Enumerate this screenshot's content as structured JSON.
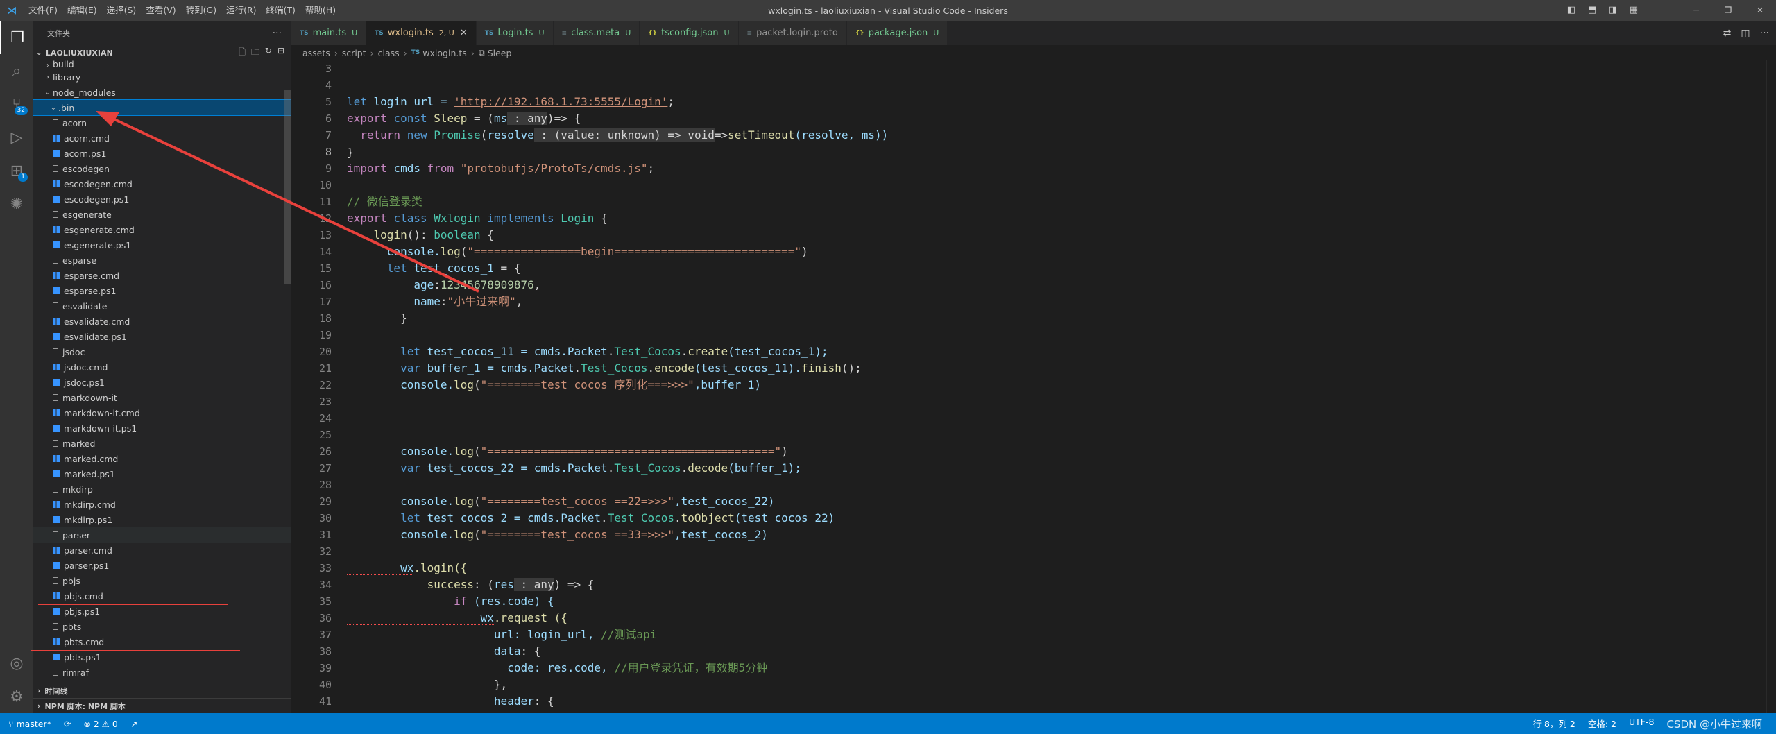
{
  "titlebar": {
    "menu": [
      "文件(F)",
      "编辑(E)",
      "选择(S)",
      "查看(V)",
      "转到(G)",
      "运行(R)",
      "终端(T)",
      "帮助(H)"
    ],
    "title": "wxlogin.ts - laoliuxiuxian - Visual Studio Code - Insiders"
  },
  "activity": {
    "scm_badge": "32",
    "ext_badge": "1"
  },
  "sidebar": {
    "header": "文件夹",
    "project": "LAOLIUXIUXIAN",
    "folders": [
      "build",
      "library",
      "node_modules",
      ".bin"
    ],
    "files": [
      "acorn",
      "acorn.cmd",
      "acorn.ps1",
      "escodegen",
      "escodegen.cmd",
      "escodegen.ps1",
      "esgenerate",
      "esgenerate.cmd",
      "esgenerate.ps1",
      "esparse",
      "esparse.cmd",
      "esparse.ps1",
      "esvalidate",
      "esvalidate.cmd",
      "esvalidate.ps1",
      "jsdoc",
      "jsdoc.cmd",
      "jsdoc.ps1",
      "markdown-it",
      "markdown-it.cmd",
      "markdown-it.ps1",
      "marked",
      "marked.cmd",
      "marked.ps1",
      "mkdirp",
      "mkdirp.cmd",
      "mkdirp.ps1",
      "parser",
      "parser.cmd",
      "parser.ps1",
      "pbjs",
      "pbjs.cmd",
      "pbjs.ps1",
      "pbts",
      "pbts.cmd",
      "pbts.ps1",
      "rimraf"
    ],
    "timeline": "时间线",
    "npm": "NPM 脚本: NPM 脚本"
  },
  "tabs": [
    {
      "label": "main.ts",
      "icon": "TS",
      "status": "U"
    },
    {
      "label": "wxlogin.ts",
      "icon": "TS",
      "status": "2, U"
    },
    {
      "label": "Login.ts",
      "icon": "TS",
      "status": "U"
    },
    {
      "label": "class.meta",
      "icon": "≡",
      "status": "U"
    },
    {
      "label": "tsconfig.json",
      "icon": "{}",
      "status": "U"
    },
    {
      "label": "packet.login.proto",
      "icon": "≡",
      "status": ""
    },
    {
      "label": "package.json",
      "icon": "{}",
      "status": "U"
    }
  ],
  "breadcrumb": [
    "assets",
    "script",
    "class",
    "wxlogin.ts",
    "Sleep"
  ],
  "line_numbers": [
    "3",
    "4",
    "5",
    "6",
    "7",
    "8",
    "9",
    "10",
    "11",
    "12",
    "13",
    "14",
    "15",
    "16",
    "17",
    "18",
    "19",
    "20",
    "21",
    "22",
    "23",
    "24",
    "25",
    "26",
    "27",
    "28",
    "29",
    "30",
    "31",
    "32",
    "33",
    "34",
    "35",
    "36",
    "37",
    "38",
    "39",
    "40",
    "41"
  ],
  "code": {
    "l5a": "let",
    "l5b": " login_url = ",
    "l5c": "'http://192.168.1.73:5555/Login'",
    "l5d": ";",
    "l6a": "export",
    "l6b": " const ",
    "l6c": "Sleep",
    "l6d": " = (",
    "l6e": "ms",
    "l6f": " : any",
    ") => {": "",
    "l6g": ")=> {",
    "l7a": "  return ",
    "l7b": "new ",
    "l7c": "Promise",
    "l7d": "(",
    "l7e": "resolve",
    "l7f": " : (value: unknown) => void",
    "l7g": "=>",
    "l7h": "setTimeout",
    "l7i": "(resolve, ms))",
    "l8": "}",
    "l9a": "import",
    "l9b": " cmds ",
    "l9c": "from",
    "l9d": " \"protobufjs/ProtoTs/cmds.js\"",
    "l9e": ";",
    "l11": "// 微信登录类",
    "l12a": "export",
    "l12b": " class ",
    "l12c": "Wxlogin",
    "l12d": " implements ",
    "l12e": "Login",
    "l12f": " {",
    "l13a": "    login",
    "l13b": "(): ",
    "l13c": "boolean",
    "l13d": " {",
    "l14a": "      console.",
    "l14b": "log",
    "l14c": "(",
    "l14d": "\"================begin===========================\"",
    "l14e": ")",
    "l15a": "      let ",
    "l15b": "test_cocos_1",
    "l15c": " = {",
    "l16a": "          age",
    "l16b": ":",
    "l16c": "12345678909876",
    "l16d": ",",
    "l17a": "          name",
    "l17b": ":",
    "l17c": "\"小牛过来啊\"",
    "l17d": ",",
    "l18": "        }",
    "l20a": "        let ",
    "l20b": "test_cocos_11",
    "l20c": " = cmds.",
    "l20d": "Packet",
    "l20e": ".",
    "l20f": "Test_Cocos",
    "l20g": ".",
    "l20h": "create",
    "l20i": "(test_cocos_1);",
    "l21a": "        var ",
    "l21b": "buffer_1",
    "l21c": " = cmds.",
    "l21d": "Packet",
    "l21e": ".",
    "l21f": "Test_Cocos",
    "l21g": ".",
    "l21h": "encode",
    "l21i": "(test_cocos_11).",
    "l21j": "finish",
    "l21k": "();",
    "l22a": "        console.",
    "l22b": "log",
    "l22c": "(",
    "l22d": "\"========test_cocos 序列化===>>>\"",
    "l22e": ",buffer_1)",
    "l26a": "        console.",
    "l26b": "log",
    "l26c": "(",
    "l26d": "\"===========================================\"",
    "l26e": ")",
    "l27a": "        var ",
    "l27b": "test_cocos_22",
    "l27c": " = cmds.",
    "l27d": "Packet",
    "l27e": ".",
    "l27f": "Test_Cocos",
    "l27g": ".",
    "l27h": "decode",
    "l27i": "(buffer_1);",
    "l29a": "        console.",
    "l29b": "log",
    "l29c": "(",
    "l29d": "\"========test_cocos ==22=>>>\"",
    "l29e": ",test_cocos_22)",
    "l30a": "        let ",
    "l30b": "test_cocos_2",
    "l30c": " = cmds.",
    "l30d": "Packet",
    "l30e": ".",
    "l30f": "Test_Cocos",
    "l30g": ".",
    "l30h": "toObject",
    "l30i": "(test_cocos_22)",
    "l31a": "        console.",
    "l31b": "log",
    "l31c": "(",
    "l31d": "\"========test_cocos ==33=>>>\"",
    "l31e": ",test_cocos_2)",
    "l33a": "        wx",
    "l33b": ".login({",
    "l34a": "            success",
    "l34b": ": (",
    "l34c": "res",
    "l34d": " : any",
    "l34e": ") => {",
    "l35a": "                if ",
    "l35b": "(res.code) {",
    "l36a": "                    wx",
    "l36b": ".request ({",
    "l37a": "                      url",
    "l37b": ": login_url, ",
    "l37c": "//测试api",
    "l38a": "                      data",
    "l38b": ": {",
    "l39a": "                        code",
    "l39b": ": res.code, ",
    "l39c": "//用户登录凭证，有效期5分钟",
    "l40": "                      },",
    "l41a": "                      header",
    "l41b": ": {"
  },
  "status": {
    "branch": "master*",
    "errors": "⊗ 2 ⚠ 0",
    "position": "行 8，列 2",
    "spaces": "空格: 2",
    "encoding": "UTF-8",
    "watermark": "CSDN @小牛过来啊"
  },
  "colors": {
    "accent": "#007acc",
    "arrow": "#e8413c"
  }
}
